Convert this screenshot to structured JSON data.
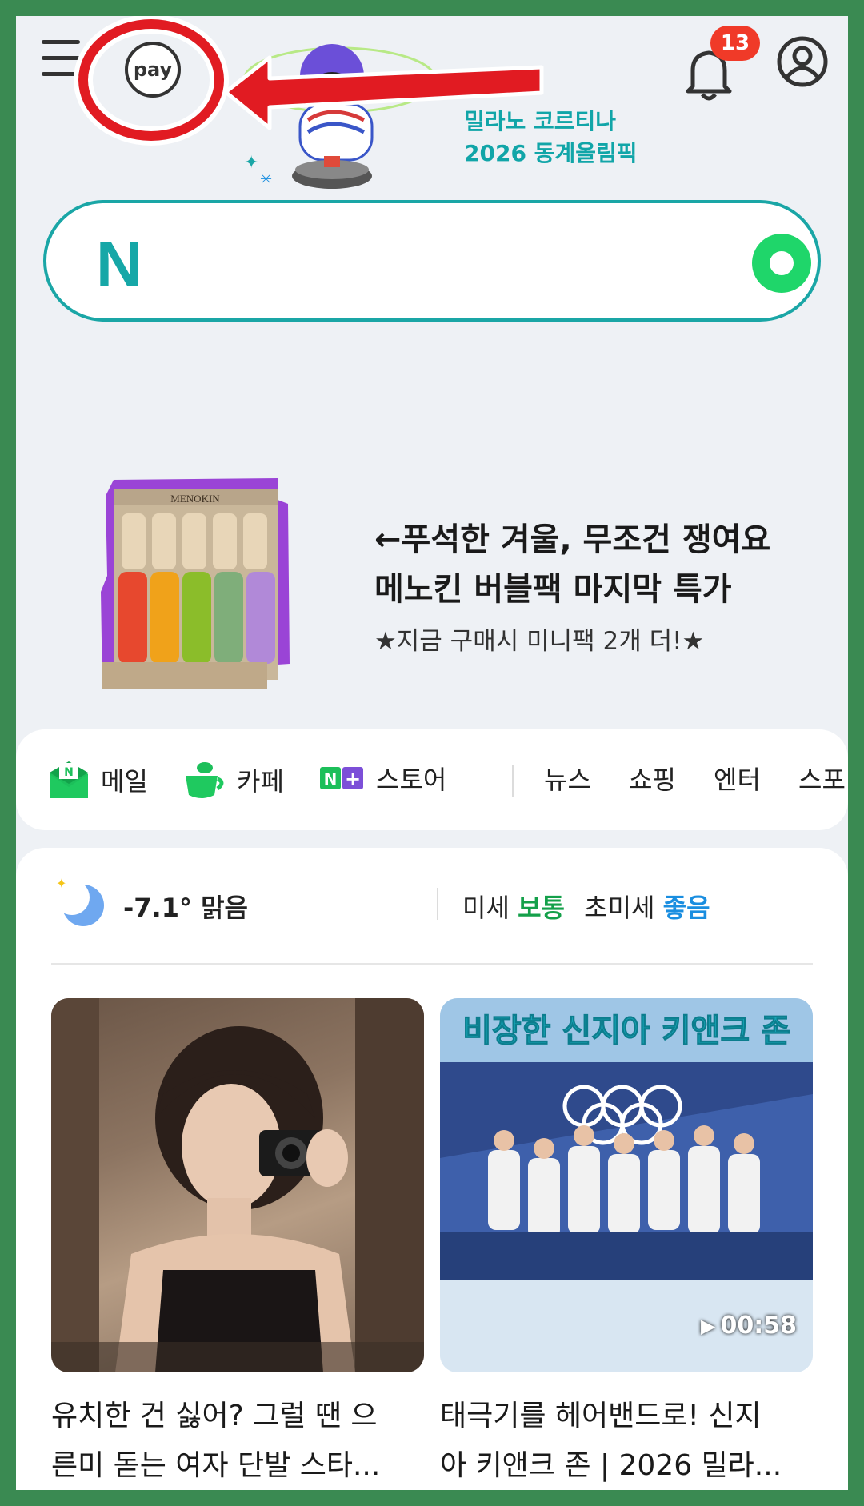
{
  "header": {
    "pay_label": "pay",
    "olympic_line1": "밀라노 코르티나",
    "olympic_line2": "2026 동계올림픽",
    "notification_count": "13"
  },
  "ad": {
    "line1": "←푸석한 겨울, 무조건 쟁여요",
    "line2": "메노킨 버블팩 마지막 특가",
    "sub": "★지금 구매시 미니팩 2개 더!★",
    "product_brand": "MENOKIN"
  },
  "shortcuts": [
    {
      "label": "메일"
    },
    {
      "label": "카페"
    },
    {
      "label": "스토어"
    },
    {
      "label": "뉴스"
    },
    {
      "label": "쇼핑"
    },
    {
      "label": "엔터"
    },
    {
      "label": "스포"
    }
  ],
  "weather": {
    "temp": "-7.1° 맑음",
    "fine_dust_label": "미세",
    "fine_dust_value": "보통",
    "ultra_dust_label": "초미세",
    "ultra_dust_value": "좋음"
  },
  "feed": [
    {
      "caption_line1": "유치한 건 싫어? 그럴 땐 으",
      "caption_line2": "른미 돋는 여자 단발 스타..."
    },
    {
      "banner": "비장한 신지아 키앤크 존",
      "duration": "00:58",
      "caption_line1": "태극기를 헤어밴드로! 신지",
      "caption_line2": "아 키앤크 존 | 2026 밀라..."
    }
  ],
  "colors": {
    "frame_border": "#3a8a52",
    "naver_teal": "#1aa6a6",
    "highlight_red": "#e11b22",
    "dust_normal": "#14a04a",
    "dust_good": "#1a8ee0"
  }
}
